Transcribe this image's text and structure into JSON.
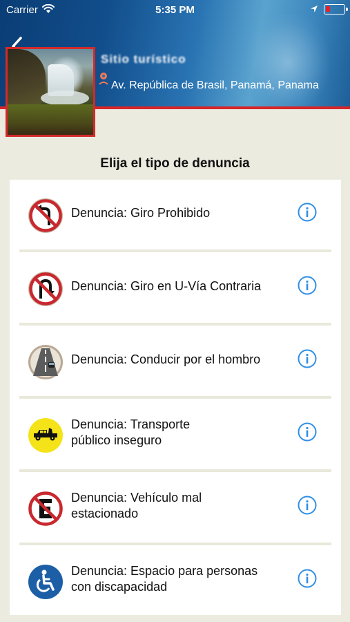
{
  "status_bar": {
    "carrier": "Carrier",
    "time": "5:35 PM"
  },
  "header": {
    "place_name": "Sitio turístico",
    "address": "Av. República de Brasil, Panamá, Panama"
  },
  "title": "Elija el tipo de denuncia",
  "items": [
    {
      "label": "Denuncia: Giro Prohibido",
      "icon": "no-left-turn-icon"
    },
    {
      "label": "Denuncia: Giro en U-Vía Contraria",
      "icon": "no-u-turn-icon"
    },
    {
      "label": "Denuncia: Conducir por el hombro",
      "icon": "road-shoulder-icon"
    },
    {
      "label_line1": "Denuncia: Transporte",
      "label_line2": "público inseguro",
      "icon": "unsafe-transport-icon"
    },
    {
      "label_line1": "Denuncia: Vehículo mal",
      "label_line2": "estacionado",
      "icon": "no-parking-icon"
    },
    {
      "label_line1": "Denuncia: Espacio para personas",
      "label_line2": "con discapacidad",
      "icon": "wheelchair-icon"
    }
  ],
  "colors": {
    "accent": "#2f8fe6",
    "header_red": "#d6262a",
    "sign_red": "#c8282e"
  }
}
